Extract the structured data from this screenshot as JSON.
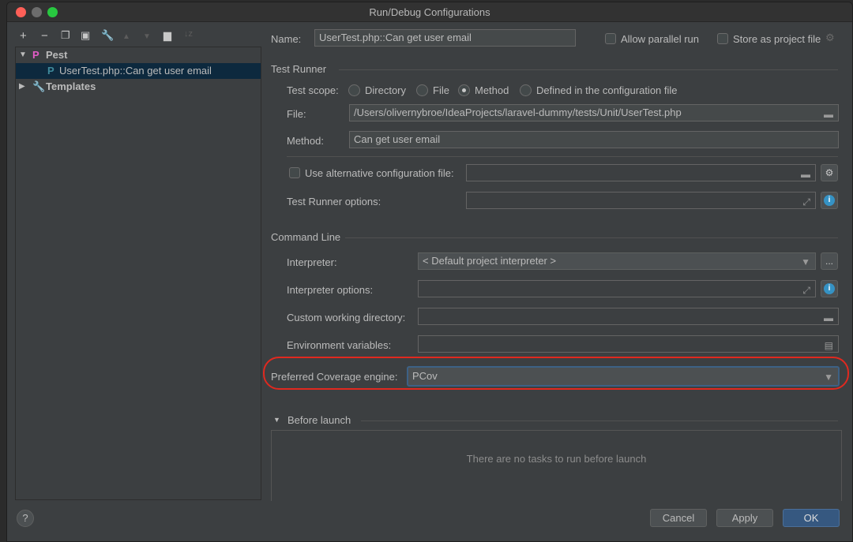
{
  "window": {
    "title": "Run/Debug Configurations"
  },
  "toolbar": {
    "icons": [
      "plus-icon",
      "minus-icon",
      "copy-icon",
      "save-icon",
      "wrench-icon",
      "arrow-up-icon",
      "arrow-down-icon",
      "new-folder-icon",
      "sort-icon"
    ]
  },
  "tree": {
    "items": [
      {
        "label": "Pest",
        "icon": "pest-icon"
      },
      {
        "label": "UserTest.php::Can get user email",
        "icon": "pest-icon",
        "selected": true
      },
      {
        "label": "Templates",
        "icon": "wrench-icon"
      }
    ]
  },
  "name": {
    "label": "Name:",
    "value": "UserTest.php::Can get user email"
  },
  "options": {
    "allow_parallel": "Allow parallel run",
    "store_project": "Store as project file"
  },
  "test_runner": {
    "title": "Test Runner",
    "scope_label": "Test scope:",
    "scopes": [
      "Directory",
      "File",
      "Method",
      "Defined in the configuration file"
    ],
    "selected_scope": "Method",
    "file_label": "File:",
    "file_value": "/Users/olivernybroe/IdeaProjects/laravel-dummy/tests/Unit/UserTest.php",
    "method_label": "Method:",
    "method_value": "Can get user email",
    "alt_config_label": "Use alternative configuration file:",
    "runner_options_label": "Test Runner options:"
  },
  "command_line": {
    "title": "Command Line",
    "interpreter_label": "Interpreter:",
    "interpreter_value": "< Default project interpreter >",
    "more": "...",
    "interp_options_label": "Interpreter options:",
    "workdir_label": "Custom working directory:",
    "env_label": "Environment variables:"
  },
  "coverage": {
    "label": "Preferred Coverage engine:",
    "value": "PCov",
    "highlight_color": "#e0291f"
  },
  "before_launch": {
    "title": "Before launch",
    "empty": "There are no tasks to run before launch"
  },
  "buttons": {
    "help": "?",
    "cancel": "Cancel",
    "apply": "Apply",
    "ok": "OK"
  },
  "colors": {
    "accent": "#365880",
    "selection": "#0d293e"
  }
}
